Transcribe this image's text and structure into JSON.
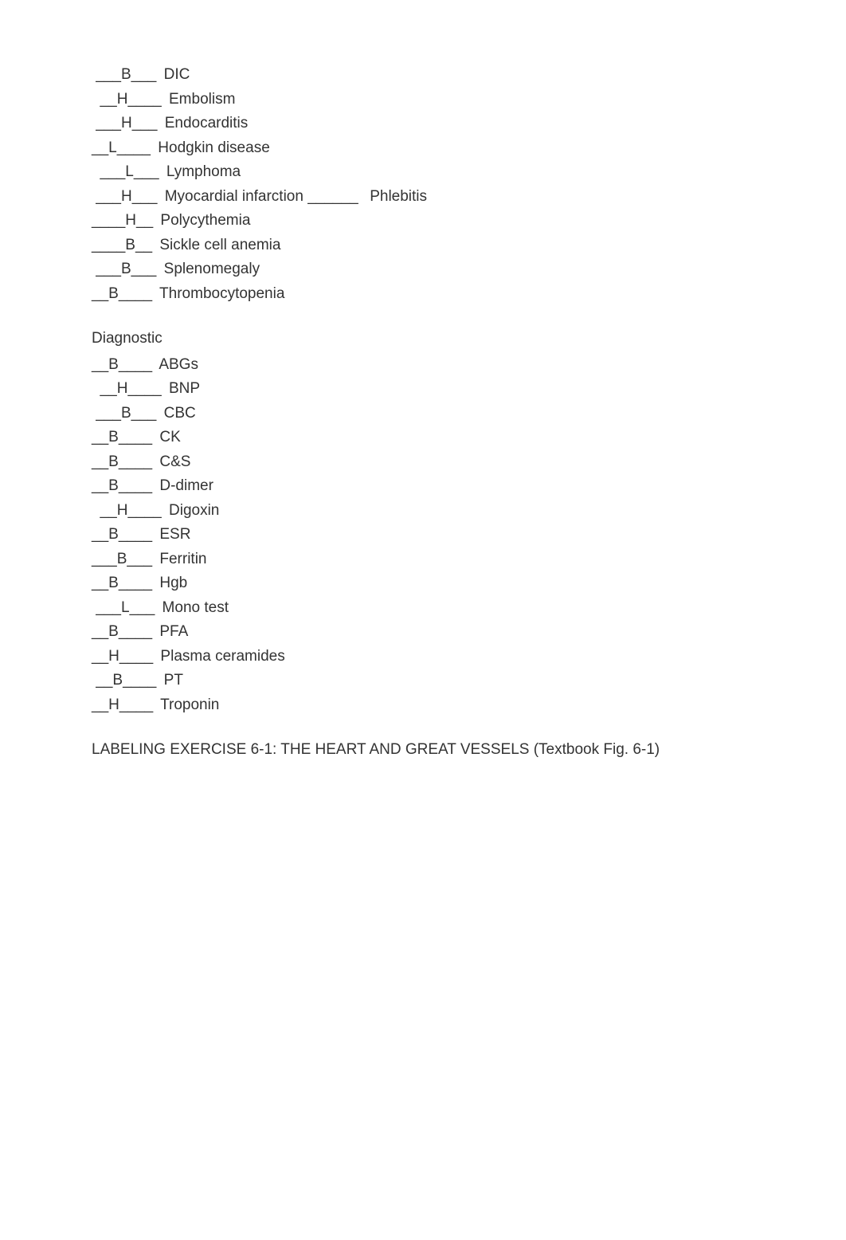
{
  "section1": {
    "rows": [
      {
        "prefix": " ___",
        "answer": "B",
        "suffix": "___",
        "term": "DIC"
      },
      {
        "prefix": "  __",
        "answer": "H",
        "suffix": "____",
        "term": "Embolism"
      },
      {
        "prefix": " ___",
        "answer": "H",
        "suffix": "___",
        "term": "Endocarditis"
      },
      {
        "prefix": "__",
        "answer": "L",
        "suffix": "____",
        "term": "Hodgkin disease"
      },
      {
        "prefix": "  ___",
        "answer": "L",
        "suffix": "___",
        "term": "Lymphoma"
      },
      {
        "prefix": " ___",
        "answer": "H",
        "suffix": "___",
        "term": "Myocardial infarction",
        "blank2": " ______ ",
        "term2": "Phlebitis"
      },
      {
        "prefix": "____",
        "answer": "H",
        "suffix": "__",
        "term": "Polycythemia"
      },
      {
        "prefix": "____",
        "answer": "B",
        "suffix": "__",
        "term": "Sickle cell anemia"
      },
      {
        "prefix": " ___",
        "answer": "B",
        "suffix": "___",
        "term": "Splenomegaly"
      },
      {
        "prefix": "__",
        "answer": "B",
        "suffix": "____",
        "term": "Thrombocytopenia"
      }
    ]
  },
  "section2": {
    "title": "Diagnostic",
    "rows": [
      {
        "prefix": "__",
        "answer": "B",
        "suffix": "____",
        "term": "ABGs"
      },
      {
        "prefix": "  __",
        "answer": "H",
        "suffix": "____",
        "term": "BNP"
      },
      {
        "prefix": " ___",
        "answer": "B",
        "suffix": "___",
        "term": "CBC"
      },
      {
        "prefix": "__",
        "answer": "B",
        "suffix": "____",
        "term": "CK"
      },
      {
        "prefix": "__",
        "answer": "B",
        "suffix": "____",
        "term": "C&S"
      },
      {
        "prefix": "__",
        "answer": "B",
        "suffix": "____",
        "term": "D-dimer"
      },
      {
        "prefix": "  __",
        "answer": "H",
        "suffix": "____",
        "term": "Digoxin"
      },
      {
        "prefix": "__",
        "answer": "B",
        "suffix": "____",
        "term": "ESR"
      },
      {
        "prefix": "___",
        "answer": "B",
        "suffix": "___",
        "term": "Ferritin"
      },
      {
        "prefix": "__",
        "answer": "B",
        "suffix": "____",
        "term": "Hgb"
      },
      {
        "prefix": " ___",
        "answer": "L",
        "suffix": "___",
        "term": "Mono test"
      },
      {
        "prefix": "__",
        "answer": "B",
        "suffix": "____",
        "term": "PFA"
      },
      {
        "prefix": "__",
        "answer": "H",
        "suffix": "____",
        "term": "Plasma ceramides"
      },
      {
        "prefix": " __",
        "answer": "B",
        "suffix": "____",
        "term": "PT"
      },
      {
        "prefix": "__",
        "answer": "H",
        "suffix": "____",
        "term": "Troponin"
      }
    ]
  },
  "heading": "LABELING EXERCISE 6-1: THE HEART AND GREAT VESSELS (Textbook Fig. 6-1)"
}
